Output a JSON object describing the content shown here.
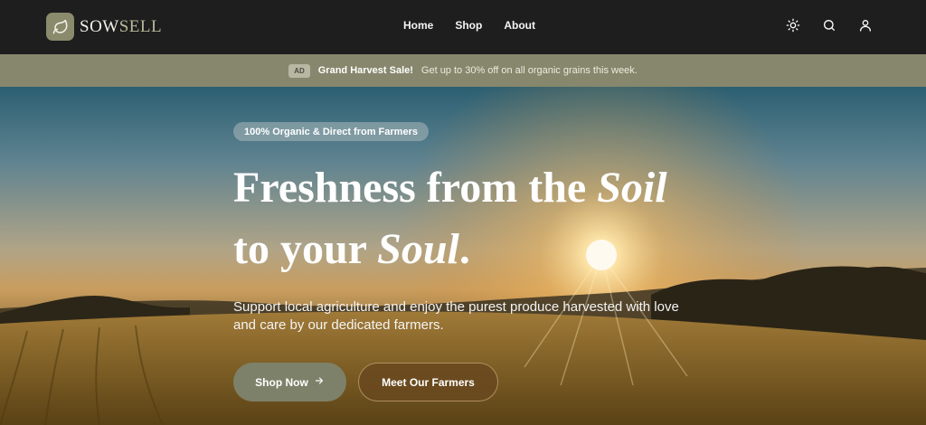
{
  "brand": {
    "name_part1": "SOW",
    "name_part2": "SELL",
    "logo_icon": "leaf-icon"
  },
  "nav": {
    "links": [
      {
        "label": "Home"
      },
      {
        "label": "Shop"
      },
      {
        "label": "About"
      }
    ],
    "icons": [
      "sun-icon",
      "search-icon",
      "user-icon"
    ]
  },
  "promo": {
    "badge": "AD",
    "title": "Grand Harvest Sale!",
    "text": "Get up to 30% off on all organic grains this week."
  },
  "hero": {
    "tagline": "100% Organic & Direct from Farmers",
    "headline_part1": "Freshness from the ",
    "headline_em1": "Soil",
    "headline_part2": "to your ",
    "headline_em2": "Soul",
    "headline_end": ".",
    "subtitle": "Support local agriculture and enjoy the purest produce harvested with love and care by our dedicated farmers.",
    "primary_button": "Shop Now",
    "secondary_button": "Meet Our Farmers"
  },
  "colors": {
    "nav_bg": "#1e1e1e",
    "accent_olive": "#86876c",
    "button_primary": "#7e8169",
    "button_secondary": "#69481e"
  }
}
